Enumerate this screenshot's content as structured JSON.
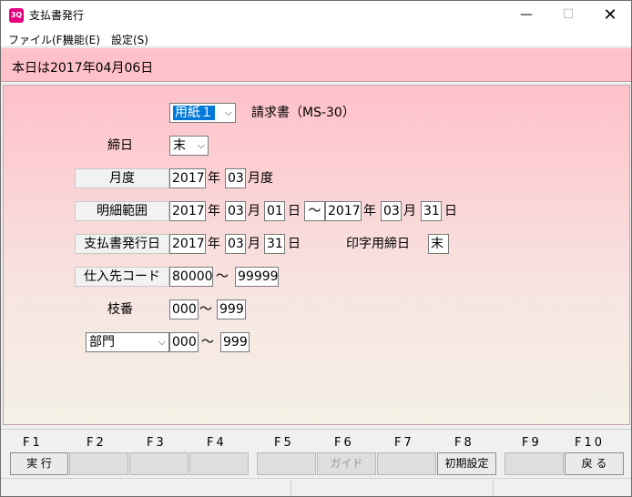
{
  "window": {
    "icon_text": "3Q",
    "title": "支払書発行",
    "minimize": "—",
    "maximize": "☐",
    "close": "✕"
  },
  "menu": [
    "ファイル(F)",
    "機能(E)",
    "設定(S)"
  ],
  "today_text": "本日は2017年04月06日",
  "form": {
    "paper_select": "用紙１",
    "paper_desc": "請求書（MS-30）",
    "closing_label": "締日",
    "closing_value": "末",
    "month_label": "月度",
    "month_year": "2017",
    "month_month": "03",
    "year_char": "年",
    "month_suffix": "月度",
    "detail_label": "明細範囲",
    "detail_from_year": "2017",
    "detail_from_month": "03",
    "detail_from_day": "01",
    "detail_to_year": "2017",
    "detail_to_month": "03",
    "detail_to_day": "31",
    "month_char": "月",
    "day_char": "日",
    "tilde": "～",
    "issue_label": "支払書発行日",
    "issue_year": "2017",
    "issue_month": "03",
    "issue_day": "31",
    "print_closing_label": "印字用締日",
    "print_closing_value": "末",
    "supplier_label": "仕入先コード",
    "supplier_from": "80000",
    "supplier_to": "99999",
    "branch_label": "枝番",
    "branch_from": "000",
    "branch_to": "999",
    "dept_select": "部門",
    "dept_from": "000",
    "dept_to": "999",
    "dropdown_arrow": "⌵"
  },
  "fkeys": [
    {
      "key": "F1",
      "label": "実 行"
    },
    {
      "key": "F2",
      "label": ""
    },
    {
      "key": "F3",
      "label": ""
    },
    {
      "key": "F4",
      "label": ""
    },
    {
      "key": "F5",
      "label": ""
    },
    {
      "key": "F6",
      "label": "ガイド"
    },
    {
      "key": "F7",
      "label": ""
    },
    {
      "key": "F8",
      "label": "初期設定"
    },
    {
      "key": "F9",
      "label": ""
    },
    {
      "key": "F10",
      "label": "戻 る"
    }
  ]
}
